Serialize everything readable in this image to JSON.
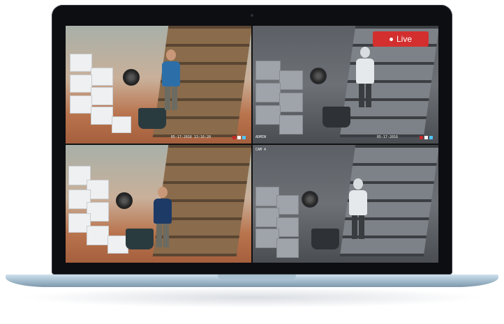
{
  "live_badge": {
    "label": "Live",
    "color": "#d32f2f"
  },
  "feeds": [
    {
      "mode": "color",
      "timestamp": "05-17-2016 13:16:20",
      "channel": ""
    },
    {
      "mode": "infrared",
      "timestamp": "05-17-2016",
      "channel": "ADMIN"
    },
    {
      "mode": "color",
      "timestamp": "",
      "channel": ""
    },
    {
      "mode": "infrared",
      "timestamp": "",
      "channel": "CAM 4"
    }
  ],
  "icons": [
    "laptop-icon",
    "camera-icon",
    "record-dot-icon"
  ]
}
